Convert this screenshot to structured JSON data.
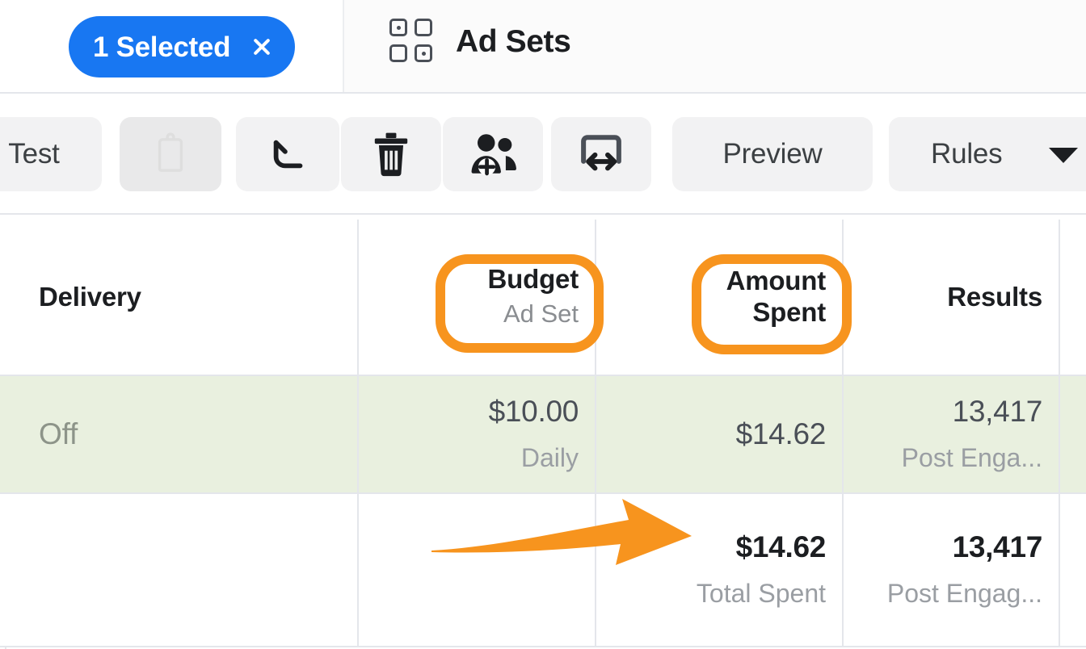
{
  "tabs": {
    "selected_pill": {
      "label": "1 Selected",
      "close_icon": "close-icon"
    },
    "active_tab": {
      "label": "Ad Sets",
      "icon": "grid-2x2-icon"
    }
  },
  "toolbar": {
    "buttons": [
      {
        "id": "test",
        "label": "Test",
        "icon": "",
        "type": "text",
        "disabled": false
      },
      {
        "id": "tag",
        "label": "",
        "icon": "tag-icon",
        "type": "icon",
        "disabled": true
      },
      {
        "id": "undo",
        "label": "",
        "icon": "undo-arrow-icon",
        "type": "icon",
        "disabled": false
      },
      {
        "id": "delete",
        "label": "",
        "icon": "trash-icon",
        "type": "icon",
        "disabled": false
      },
      {
        "id": "audience",
        "label": "",
        "icon": "add-people-icon",
        "type": "icon",
        "disabled": false
      },
      {
        "id": "abtest",
        "label": "",
        "icon": "ab-test-swap-icon",
        "type": "icon",
        "disabled": false
      },
      {
        "id": "preview",
        "label": "Preview",
        "icon": "",
        "type": "text",
        "disabled": false
      },
      {
        "id": "rules",
        "label": "Rules",
        "icon": "chevron-down-icon",
        "type": "dropdown",
        "disabled": false
      }
    ]
  },
  "table": {
    "headers": {
      "delivery": {
        "main": "Delivery",
        "sub": ""
      },
      "budget": {
        "main": "Budget",
        "sub": "Ad Set"
      },
      "spent": {
        "main": "Amount",
        "sub2": "Spent"
      },
      "results": {
        "main": "Results",
        "sub": ""
      }
    },
    "rows": [
      {
        "kind": "ad-set-row",
        "highlighted": true,
        "delivery": "Off",
        "budget_value": "$10.00",
        "budget_sub": "Daily",
        "spent_value": "$14.62",
        "spent_sub": "",
        "results_value": "13,417",
        "results_sub": "Post Enga..."
      },
      {
        "kind": "totals-row",
        "highlighted": false,
        "delivery": "",
        "budget_value": "",
        "budget_sub": "",
        "spent_value": "$14.62",
        "spent_sub": "Total Spent",
        "results_value": "13,417",
        "results_sub": "Post Engag..."
      }
    ]
  },
  "annotations": {
    "color": "#f7941e",
    "highlight_budget_header": "Budget",
    "highlight_spent_header": "Amount Spent",
    "arrow_points_to": "$14.62"
  },
  "colors": {
    "accent_blue": "#1877f2",
    "annotation_orange": "#f7941e",
    "row_highlight_green": "#e9f0df"
  }
}
